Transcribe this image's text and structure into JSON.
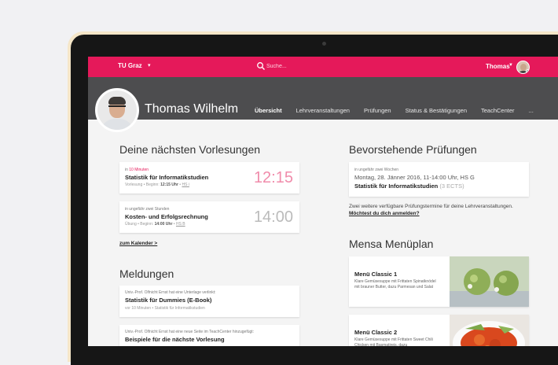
{
  "app": {
    "brand": "TU Graz",
    "search_placeholder": "Suche...",
    "user": "Thomas"
  },
  "profile": {
    "name": "Thomas Wilhelm"
  },
  "tabs": [
    "Übersicht",
    "Lehrveranstaltungen",
    "Prüfungen",
    "Status & Bestätigungen",
    "TeachCenter",
    "..."
  ],
  "lectures": {
    "title": "Deine nächsten Vorlesungen",
    "items": [
      {
        "meta_prefix": "in ",
        "meta_highlight": "10 Minuten",
        "title": "Statistik für Informatikstudien",
        "sub_prefix": "Vorlesung • Beginn: ",
        "sub_time": "12:15 Uhr",
        "sub_sep": " • ",
        "sub_room": "HS i",
        "time": "12:15"
      },
      {
        "meta_prefix": "in ungefähr zwei Stunden",
        "meta_highlight": "",
        "title": "Kosten- und Erfolgsrechnung",
        "sub_prefix": "Übung • Beginn: ",
        "sub_time": "14:00 Uhr",
        "sub_sep": " • ",
        "sub_room": "HS B",
        "time": "14:00"
      }
    ],
    "calendar_link": "zum Kalender >"
  },
  "exams": {
    "title": "Bevorstehende Prüfungen",
    "meta": "in ungefähr zwei Wochen",
    "date": "Montag, 28. Jänner 2016, 11-14:00 Uhr, HS G",
    "course": "Statistik für Informatikstudien",
    "ects": "(3 ECTS)",
    "note": "Zwei weitere verfügbare Prüfungstermine für deine Lehrveranstaltungen.",
    "note_link": "Möchtest du dich anmelden?"
  },
  "news": {
    "title": "Meldungen",
    "items": [
      {
        "meta": "Univ.-Prof. Olfnicht Ernst hat eine Unterlage verlinkt:",
        "title": "Statistik für Dummies (E-Book)",
        "sub": "vor 10 Minuten • Statistik für Informatikstudien"
      },
      {
        "meta": "Univ.-Prof. Olfnicht Ernst hat eine neue Seite im TeachCenter hinzugefügt:",
        "title": "Beispiele für die nächste Vorlesung",
        "sub": ""
      }
    ]
  },
  "mensa": {
    "title": "Mensa Menüplan",
    "items": [
      {
        "title": "Menü Classic 1",
        "desc": "Klare Gemüsesuppe mit Frittaten Spinatknödel mit brauner Butter, dazu Parmesan und Salat"
      },
      {
        "title": "Menü Classic 2",
        "desc": "Klare Gemüsesuppe mit Frittaten Sweet Chili Chicken mit Basmatireis, dazu"
      }
    ]
  }
}
